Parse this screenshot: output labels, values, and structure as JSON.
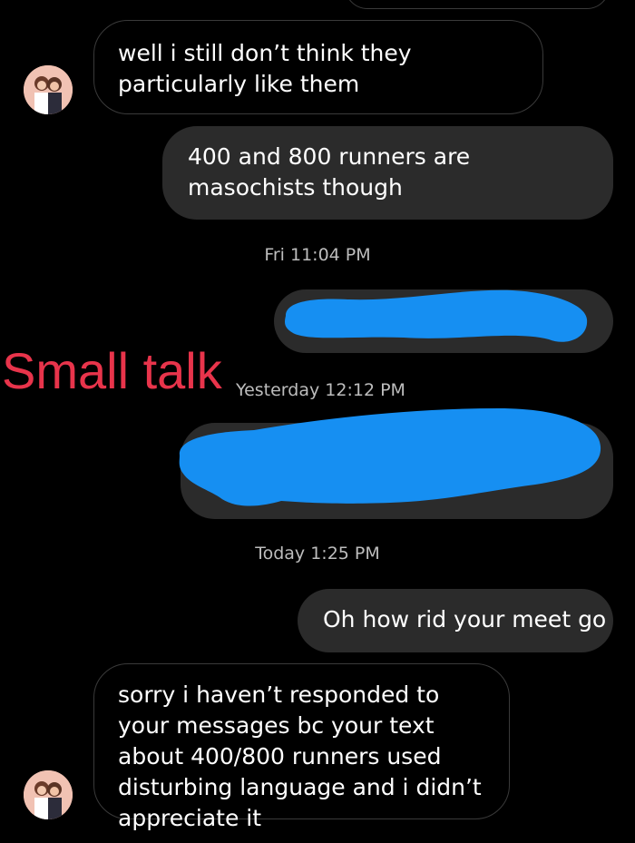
{
  "messages": {
    "m1_text": "well i still don’t think they particularly like them",
    "m2_text": "400 and 800 runners are masochists though",
    "m3_text": "Oh how rid your meet go",
    "m4_text": "sorry i haven’t responded to your messages bc your text about 400/800 runners used disturbing language and i didn’t appreciate it"
  },
  "timestamps": {
    "t1": "Fri 11:04 PM",
    "t2": "Yesterday 12:12 PM",
    "t3": "Today 1:25 PM"
  },
  "annotation": {
    "label": "Small talk"
  },
  "colors": {
    "redaction": "#168ff2",
    "annotation": "#e8344b",
    "outgoing_bubble": "#2b2b2b"
  }
}
